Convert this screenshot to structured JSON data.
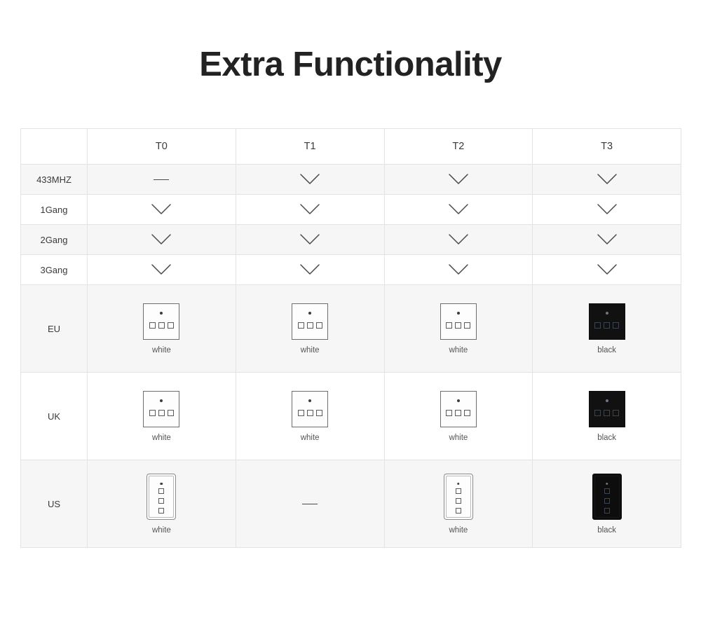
{
  "title": "Extra Functionality",
  "table": {
    "columns": [
      "",
      "T0",
      "T1",
      "T2",
      "T3"
    ],
    "feature_rows": [
      {
        "label": "433MHZ",
        "cells": [
          "dash",
          "check",
          "check",
          "check"
        ]
      },
      {
        "label": "1Gang",
        "cells": [
          "check",
          "check",
          "check",
          "check"
        ]
      },
      {
        "label": "2Gang",
        "cells": [
          "check",
          "check",
          "check",
          "check"
        ]
      },
      {
        "label": "3Gang",
        "cells": [
          "check",
          "check",
          "check",
          "check"
        ]
      }
    ],
    "image_rows": [
      {
        "label": "EU",
        "cells": [
          {
            "type": "switch",
            "shape": "square",
            "finish": "white",
            "color_label": "white",
            "buttons": 3
          },
          {
            "type": "switch",
            "shape": "square",
            "finish": "white",
            "color_label": "white",
            "buttons": 3
          },
          {
            "type": "switch",
            "shape": "square",
            "finish": "white",
            "color_label": "white",
            "buttons": 3
          },
          {
            "type": "switch",
            "shape": "square",
            "finish": "black",
            "color_label": "black",
            "buttons": 3
          }
        ]
      },
      {
        "label": "UK",
        "cells": [
          {
            "type": "switch",
            "shape": "square",
            "finish": "white",
            "color_label": "white",
            "buttons": 3
          },
          {
            "type": "switch",
            "shape": "square",
            "finish": "white",
            "color_label": "white",
            "buttons": 3
          },
          {
            "type": "switch",
            "shape": "square",
            "finish": "white",
            "color_label": "white",
            "buttons": 3
          },
          {
            "type": "switch",
            "shape": "square",
            "finish": "black",
            "color_label": "black",
            "buttons": 3
          }
        ]
      },
      {
        "label": "US",
        "cells": [
          {
            "type": "switch",
            "shape": "vertical",
            "finish": "white",
            "color_label": "white",
            "buttons": 3
          },
          {
            "type": "dash"
          },
          {
            "type": "switch",
            "shape": "vertical",
            "finish": "white",
            "color_label": "white",
            "buttons": 3
          },
          {
            "type": "switch",
            "shape": "vertical",
            "finish": "black",
            "color_label": "black",
            "buttons": 3
          }
        ]
      }
    ]
  },
  "colors": {
    "title": "#222222",
    "text": "#3a3a3a",
    "border": "#e3e3e3",
    "row_shade": "#f6f6f6",
    "switch_black": "#111111",
    "switch_outline": "#6e6e6e"
  }
}
